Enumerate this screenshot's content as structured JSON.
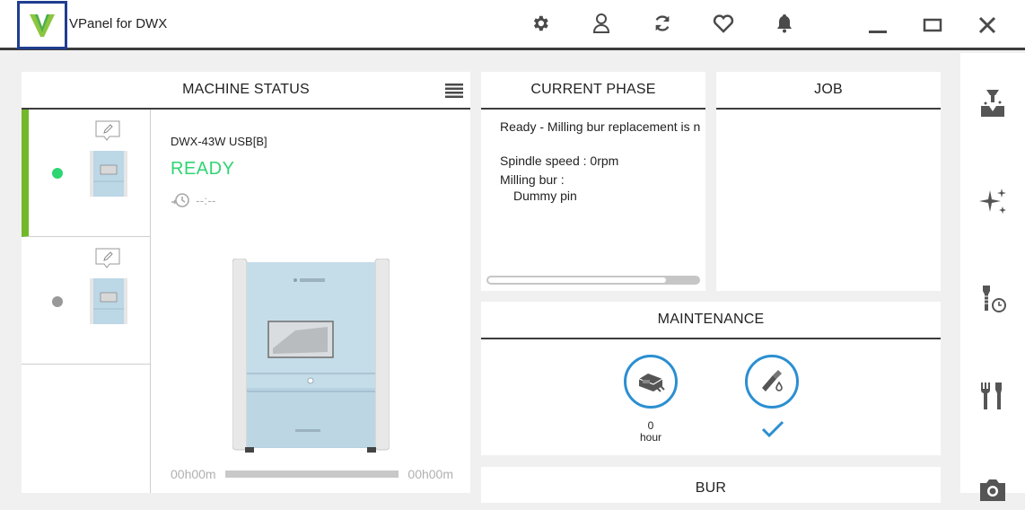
{
  "app": {
    "title": "VPanel for DWX"
  },
  "toolbar": {
    "icons": [
      "gear-icon",
      "user-icon",
      "refresh-icon",
      "heart-icon",
      "bell-icon"
    ],
    "window": [
      "minimize-icon",
      "maximize-icon",
      "close-icon"
    ]
  },
  "colors": {
    "accent_blue": "#2b8fd1",
    "ready_green": "#2ed573",
    "active_bar": "#73b82b",
    "logo_border": "#1f3e8f"
  },
  "machine_status": {
    "title": "MACHINE STATUS",
    "machines": [
      {
        "status": "active",
        "dot_color": "#2ed573"
      },
      {
        "status": "inactive",
        "dot_color": "#999999"
      }
    ],
    "selected": {
      "model": "DWX-43W USB[B]",
      "state": "READY",
      "remaining_time": "--:--",
      "elapsed": "00h00m",
      "total": "00h00m"
    }
  },
  "current_phase": {
    "title": "CURRENT PHASE",
    "status_line": "Ready - Milling bur replacement is n",
    "spindle": "Spindle speed : 0rpm",
    "bur_label": "Milling bur :",
    "bur_value": "Dummy pin"
  },
  "job": {
    "title": "JOB"
  },
  "maintenance": {
    "title": "MAINTENANCE",
    "items": [
      {
        "icon": "machine-clean-icon",
        "value": "0",
        "unit": "hour"
      },
      {
        "icon": "spindle-oil-icon",
        "value": "",
        "unit": ""
      }
    ]
  },
  "bur": {
    "title": "BUR"
  },
  "sidebar": {
    "icons": [
      "milling-icon",
      "sparkle-icon",
      "bur-timer-icon",
      "tools-icon",
      "camera-icon"
    ]
  }
}
